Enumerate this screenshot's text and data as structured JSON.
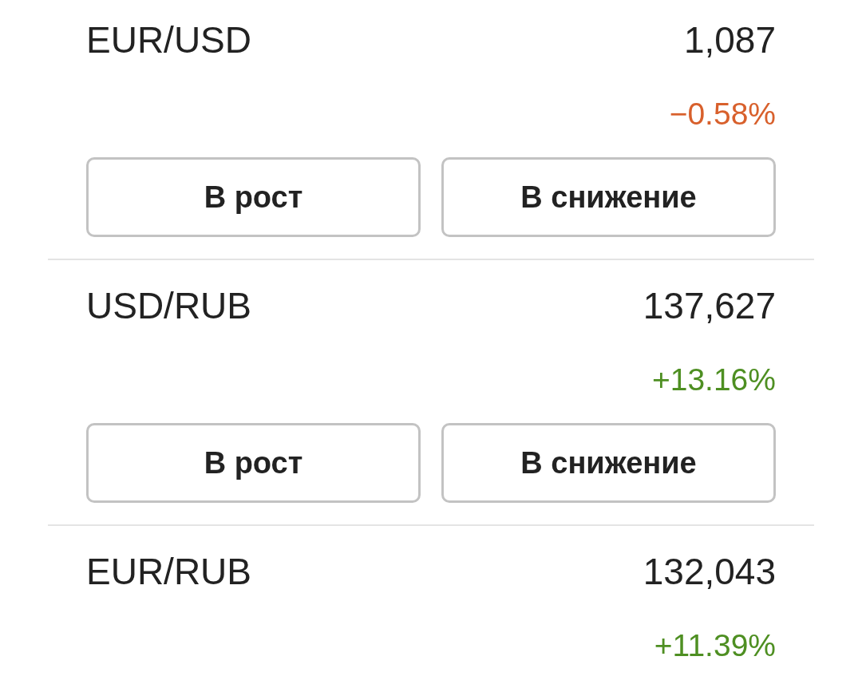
{
  "pairs": [
    {
      "name": "EUR/USD",
      "rate": "1,087",
      "change": {
        "text": "−0.58%",
        "color": "#d8602c"
      },
      "buttons": [
        "В рост",
        "В снижение"
      ]
    },
    {
      "name": "USD/RUB",
      "rate": "137,627",
      "change": {
        "text": "+13.16%",
        "color": "#4e8f22"
      },
      "buttons": [
        "В рост",
        "В снижение"
      ]
    },
    {
      "name": "EUR/RUB",
      "rate": "132,043",
      "change": {
        "text": "+11.39%",
        "color": "#4e8f22"
      }
    }
  ]
}
